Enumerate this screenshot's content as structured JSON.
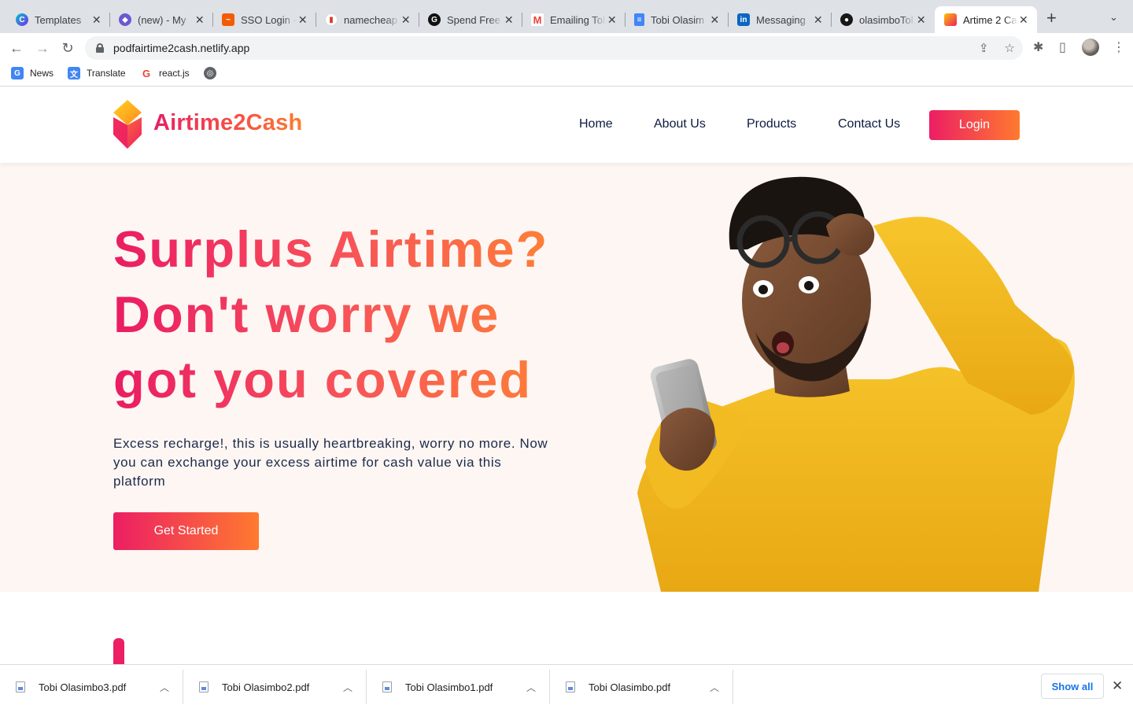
{
  "browser": {
    "tabs": [
      {
        "title": "Templates",
        "icon": "canva-icon",
        "color": "#7d2ae8"
      },
      {
        "title": "(new) - My",
        "icon": "notion-icon",
        "color": "#6a5acd"
      },
      {
        "title": "SSO Login -",
        "icon": "sso-icon",
        "color": "#f25c05"
      },
      {
        "title": "namecheap",
        "icon": "namecheap-icon",
        "color": "#de3723"
      },
      {
        "title": "Spend Free",
        "icon": "spend-icon",
        "color": "#111111"
      },
      {
        "title": "Emailing Tol",
        "icon": "gmail-icon",
        "color": "#ea4335"
      },
      {
        "title": "Tobi Olasim",
        "icon": "docs-icon",
        "color": "#4285f4"
      },
      {
        "title": "Messaging",
        "icon": "linkedin-icon",
        "color": "#0a66c2"
      },
      {
        "title": "olasimboTol",
        "icon": "github-icon",
        "color": "#181717"
      },
      {
        "title": "Artime 2 Ca",
        "icon": "airtime2cash-icon",
        "color": "#ec1e64"
      }
    ],
    "url": "podfairtime2cash.netlify.app",
    "bookmarks": [
      {
        "label": "News",
        "icon": "google-news-icon"
      },
      {
        "label": "Translate",
        "icon": "google-translate-icon"
      },
      {
        "label": "react.js",
        "icon": "google-icon"
      },
      {
        "label": "",
        "icon": "globe-icon"
      }
    ]
  },
  "site": {
    "brand": "Airtime2Cash",
    "nav": {
      "home": "Home",
      "about": "About Us",
      "products": "Products",
      "contact": "Contact Us",
      "login": "Login"
    },
    "hero": {
      "headline_line1": "Surplus Airtime?",
      "headline_line2": "Don't worry we",
      "headline_line3": "got you covered",
      "subtext": "Excess recharge!, this is usually heartbreaking, worry no more. Now you can exchange your excess airtime for cash value via this platform",
      "cta": "Get Started"
    },
    "colors": {
      "gradient_start": "#ec1e64",
      "gradient_end": "#ff7a2f",
      "hero_bg": "#fdf6f3",
      "text_dark": "#0d1b3e"
    }
  },
  "downloads": {
    "items": [
      {
        "name": "Tobi Olasimbo3.pdf"
      },
      {
        "name": "Tobi Olasimbo2.pdf"
      },
      {
        "name": "Tobi Olasimbo1.pdf"
      },
      {
        "name": "Tobi Olasimbo.pdf"
      }
    ],
    "show_all": "Show all"
  }
}
